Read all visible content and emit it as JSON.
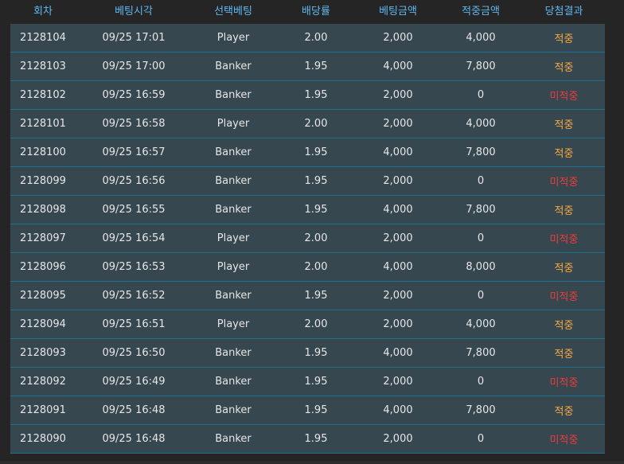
{
  "table": {
    "columns": [
      "회차",
      "베팅시각",
      "선택베팅",
      "배당률",
      "베팅금액",
      "적중금액",
      "당첨결과"
    ],
    "rows": [
      {
        "round": "2128104",
        "time": "09/25 17:01",
        "bet": "Player",
        "odds": "2.00",
        "amount": "2,000",
        "payout": "4,000",
        "result": "적중",
        "status": "win"
      },
      {
        "round": "2128103",
        "time": "09/25 17:00",
        "bet": "Banker",
        "odds": "1.95",
        "amount": "4,000",
        "payout": "7,800",
        "result": "적중",
        "status": "win"
      },
      {
        "round": "2128102",
        "time": "09/25 16:59",
        "bet": "Banker",
        "odds": "1.95",
        "amount": "2,000",
        "payout": "0",
        "result": "미적중",
        "status": "lose"
      },
      {
        "round": "2128101",
        "time": "09/25 16:58",
        "bet": "Player",
        "odds": "2.00",
        "amount": "2,000",
        "payout": "4,000",
        "result": "적중",
        "status": "win"
      },
      {
        "round": "2128100",
        "time": "09/25 16:57",
        "bet": "Banker",
        "odds": "1.95",
        "amount": "4,000",
        "payout": "7,800",
        "result": "적중",
        "status": "win"
      },
      {
        "round": "2128099",
        "time": "09/25 16:56",
        "bet": "Banker",
        "odds": "1.95",
        "amount": "2,000",
        "payout": "0",
        "result": "미적중",
        "status": "lose"
      },
      {
        "round": "2128098",
        "time": "09/25 16:55",
        "bet": "Banker",
        "odds": "1.95",
        "amount": "4,000",
        "payout": "7,800",
        "result": "적중",
        "status": "win"
      },
      {
        "round": "2128097",
        "time": "09/25 16:54",
        "bet": "Player",
        "odds": "2.00",
        "amount": "2,000",
        "payout": "0",
        "result": "미적중",
        "status": "lose"
      },
      {
        "round": "2128096",
        "time": "09/25 16:53",
        "bet": "Player",
        "odds": "2.00",
        "amount": "4,000",
        "payout": "8,000",
        "result": "적중",
        "status": "win"
      },
      {
        "round": "2128095",
        "time": "09/25 16:52",
        "bet": "Banker",
        "odds": "1.95",
        "amount": "2,000",
        "payout": "0",
        "result": "미적중",
        "status": "lose"
      },
      {
        "round": "2128094",
        "time": "09/25 16:51",
        "bet": "Player",
        "odds": "2.00",
        "amount": "2,000",
        "payout": "4,000",
        "result": "적중",
        "status": "win"
      },
      {
        "round": "2128093",
        "time": "09/25 16:50",
        "bet": "Banker",
        "odds": "1.95",
        "amount": "4,000",
        "payout": "7,800",
        "result": "적중",
        "status": "win"
      },
      {
        "round": "2128092",
        "time": "09/25 16:49",
        "bet": "Banker",
        "odds": "1.95",
        "amount": "2,000",
        "payout": "0",
        "result": "미적중",
        "status": "lose"
      },
      {
        "round": "2128091",
        "time": "09/25 16:48",
        "bet": "Banker",
        "odds": "1.95",
        "amount": "4,000",
        "payout": "7,800",
        "result": "적중",
        "status": "win"
      },
      {
        "round": "2128090",
        "time": "09/25 16:48",
        "bet": "Banker",
        "odds": "1.95",
        "amount": "2,000",
        "payout": "0",
        "result": "미적중",
        "status": "lose"
      }
    ]
  },
  "colors": {
    "header_text": "#5fb7ee",
    "row_bg": "#37474f",
    "row_border": "#1f6f8f",
    "win": "#f7a941",
    "lose": "#ef3b3b",
    "page_bg": "#252525"
  }
}
